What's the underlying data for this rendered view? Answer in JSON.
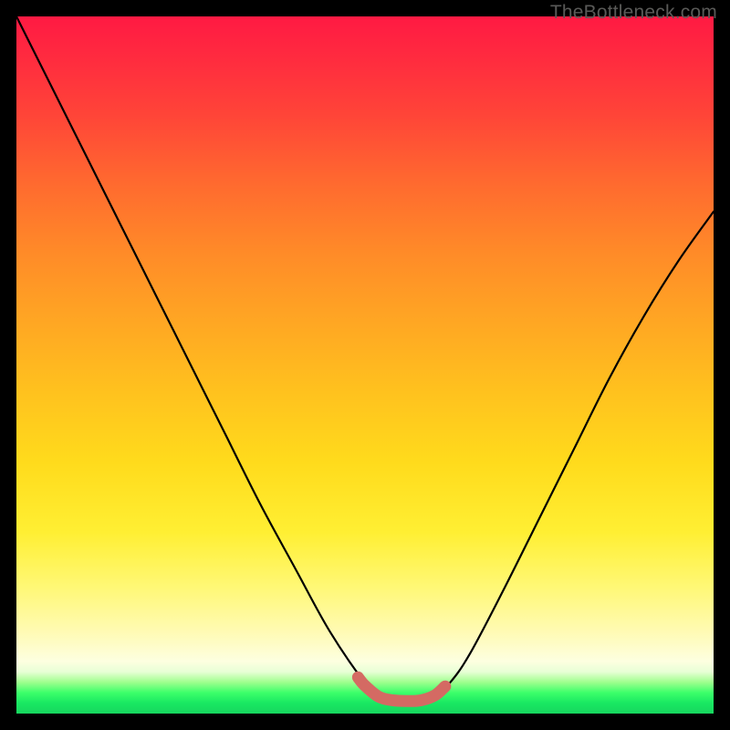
{
  "watermark": {
    "text": "TheBottleneck.com"
  },
  "chart_data": {
    "type": "line",
    "title": "",
    "xlabel": "",
    "ylabel": "",
    "xlim": [
      0,
      100
    ],
    "ylim": [
      0,
      100
    ],
    "grid": false,
    "legend": false,
    "annotations": [],
    "series": [
      {
        "name": "bottleneck-curve",
        "color": "#000000",
        "x": [
          0,
          5,
          10,
          15,
          20,
          25,
          30,
          35,
          40,
          45,
          50,
          52,
          55,
          58,
          60,
          62,
          65,
          70,
          75,
          80,
          85,
          90,
          95,
          100
        ],
        "values": [
          100,
          90,
          80,
          70,
          60,
          50,
          40,
          30,
          20.8,
          11.7,
          4.4,
          2.6,
          1.8,
          1.8,
          2.5,
          4.2,
          8.5,
          18,
          28,
          38,
          48,
          57,
          65,
          72
        ]
      },
      {
        "name": "optimal-zone-marker",
        "color": "#d46a63",
        "x": [
          49,
          50,
          52,
          54,
          56,
          58,
          60,
          61.5
        ],
        "values": [
          5.2,
          4.0,
          2.4,
          1.9,
          1.8,
          1.9,
          2.6,
          3.9
        ]
      }
    ],
    "background_gradient": {
      "stops": [
        {
          "pos": 0.0,
          "color": "#ff1a43"
        },
        {
          "pos": 0.34,
          "color": "#ff8b28"
        },
        {
          "pos": 0.64,
          "color": "#ffdb1c"
        },
        {
          "pos": 0.88,
          "color": "#fffab1"
        },
        {
          "pos": 0.95,
          "color": "#9fff8e"
        },
        {
          "pos": 1.0,
          "color": "#17d65e"
        }
      ]
    }
  }
}
